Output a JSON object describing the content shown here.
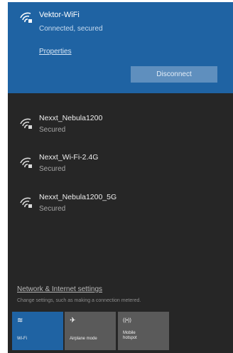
{
  "colors": {
    "panel_bg": "#262626",
    "connected_bg": "#1f63a3",
    "disconnect_btn": "#5f8fbe",
    "tile_active": "#1f63a3",
    "tile_inactive": "#5a5a5a"
  },
  "connected": {
    "name": "Vektor-WiFi",
    "status": "Connected, secured",
    "properties_label": "Properties",
    "disconnect_label": "Disconnect",
    "icon": "wifi-secured-icon"
  },
  "networks": [
    {
      "name": "Nexxt_Nebula1200",
      "status": "Secured",
      "icon": "wifi-secured-icon"
    },
    {
      "name": "Nexxt_Wi-Fi-2.4G",
      "status": "Secured",
      "icon": "wifi-secured-icon"
    },
    {
      "name": "Nexxt_Nebula1200_5G",
      "status": "Secured",
      "icon": "wifi-secured-icon"
    }
  ],
  "settings": {
    "link": "Network & Internet settings",
    "description": "Change settings, such as making a connection metered."
  },
  "quick_actions": [
    {
      "icon": "wifi-icon",
      "label": "Wi-Fi",
      "active": true
    },
    {
      "icon": "airplane-icon",
      "label": "Airplane mode",
      "active": false
    },
    {
      "icon": "mobile-hotspot-icon",
      "label_line1": "Mobile",
      "label_line2": "hotspot",
      "active": false
    }
  ],
  "icon_glyphs": {
    "wifi": "≋",
    "airplane": "✈",
    "hotspot": "((•))"
  }
}
